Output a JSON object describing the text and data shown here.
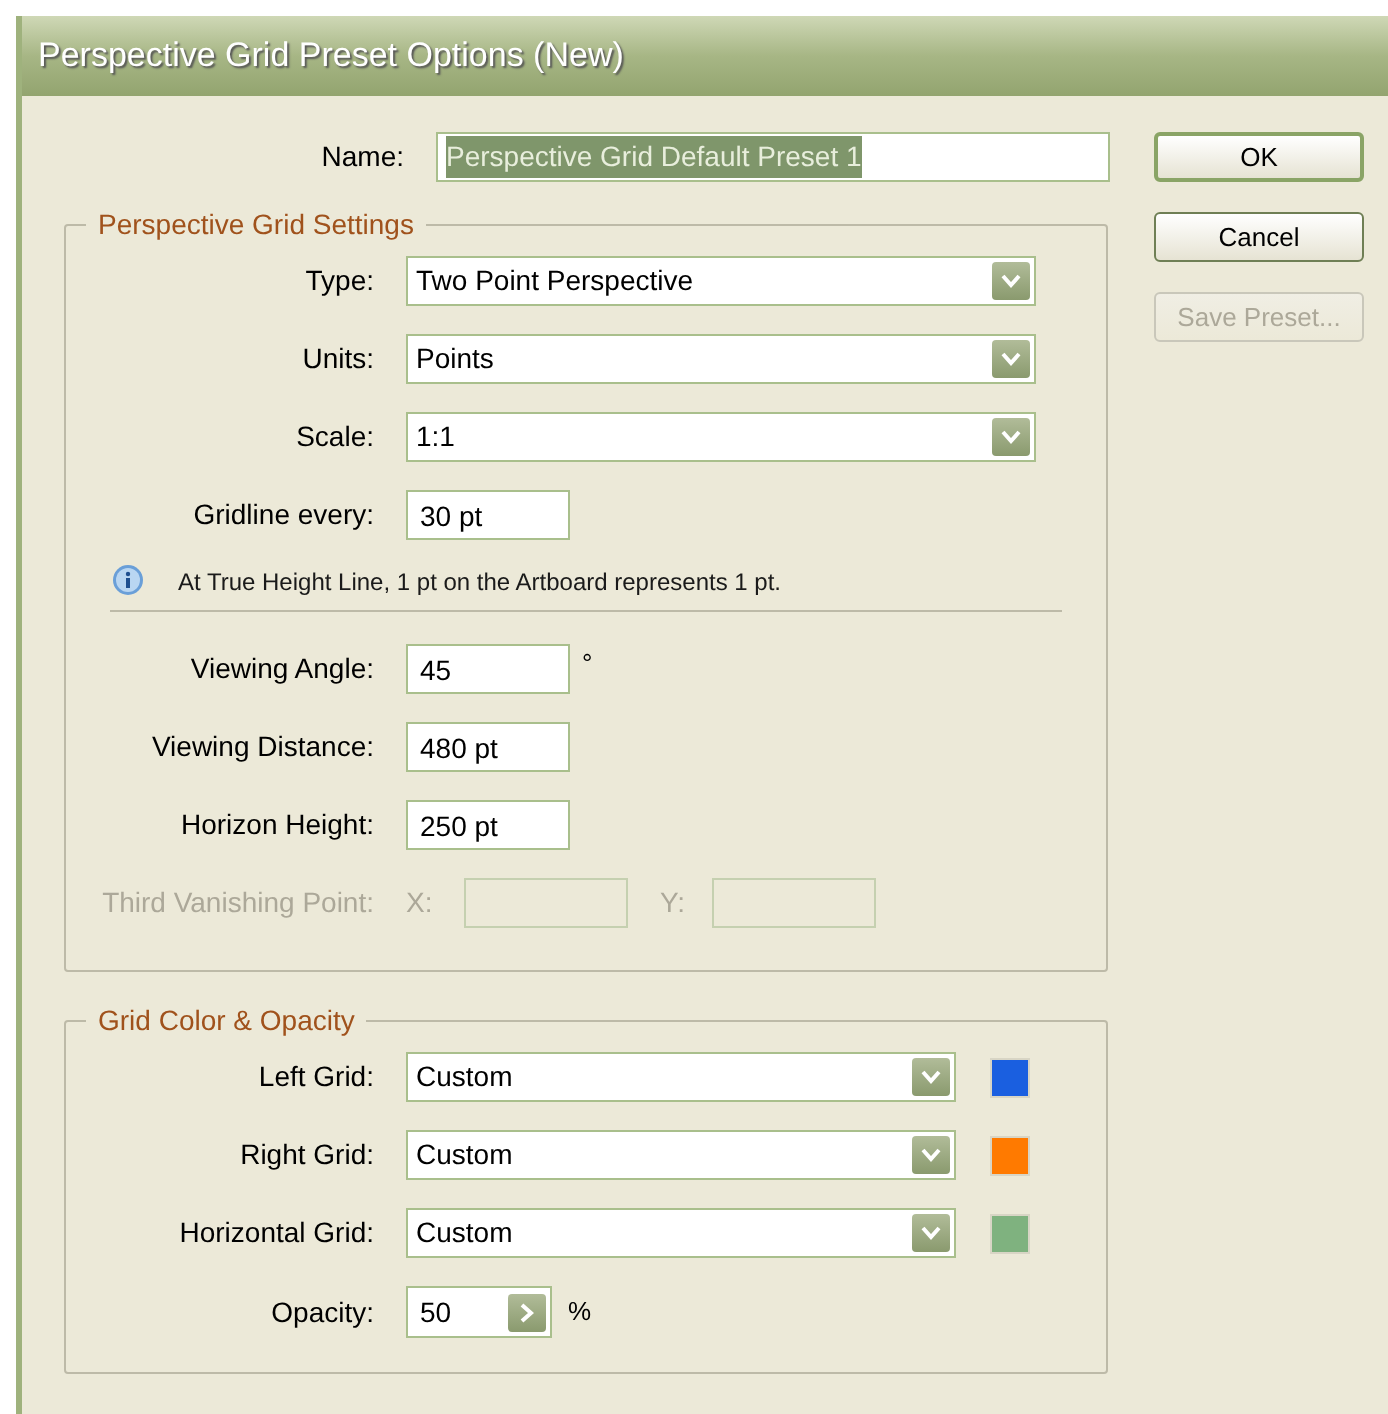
{
  "window": {
    "title": "Perspective Grid Preset Options (New)"
  },
  "name_field": {
    "label": "Name:",
    "value": "Perspective Grid Default Preset 1",
    "selected": true
  },
  "buttons": [
    {
      "label": "OK",
      "default": true,
      "disabled": false
    },
    {
      "label": "Cancel",
      "default": false,
      "disabled": false
    },
    {
      "label": "Save Preset...",
      "default": false,
      "disabled": true
    }
  ],
  "grid_settings": {
    "title": "Perspective Grid Settings",
    "dropdowns": [
      {
        "label": "Type:",
        "value": "Two Point Perspective"
      },
      {
        "label": "Units:",
        "value": "Points"
      },
      {
        "label": "Scale:",
        "value": "1:1"
      }
    ],
    "gridline": {
      "label": "Gridline every:",
      "value": "30 pt"
    },
    "info": "At True Height Line, 1 pt on the Artboard represents 1 pt.",
    "fields": [
      {
        "label": "Viewing Angle:",
        "value": "45",
        "unit": "°"
      },
      {
        "label": "Viewing Distance:",
        "value": "480 pt"
      },
      {
        "label": "Horizon Height:",
        "value": "250 pt"
      }
    ],
    "third_vanishing_point": {
      "label": "Third Vanishing Point:",
      "x_label": "X:",
      "y_label": "Y:",
      "disabled": true
    }
  },
  "color_opacity": {
    "title": "Grid Color & Opacity",
    "grids": [
      {
        "label": "Left Grid:",
        "value": "Custom",
        "color": "#1a5fe0"
      },
      {
        "label": "Right Grid:",
        "value": "Custom",
        "color": "#ff7a00"
      },
      {
        "label": "Horizontal Grid:",
        "value": "Custom",
        "color": "#7fb27f"
      }
    ],
    "opacity": {
      "label": "Opacity:",
      "value": "50",
      "unit": "%"
    }
  }
}
